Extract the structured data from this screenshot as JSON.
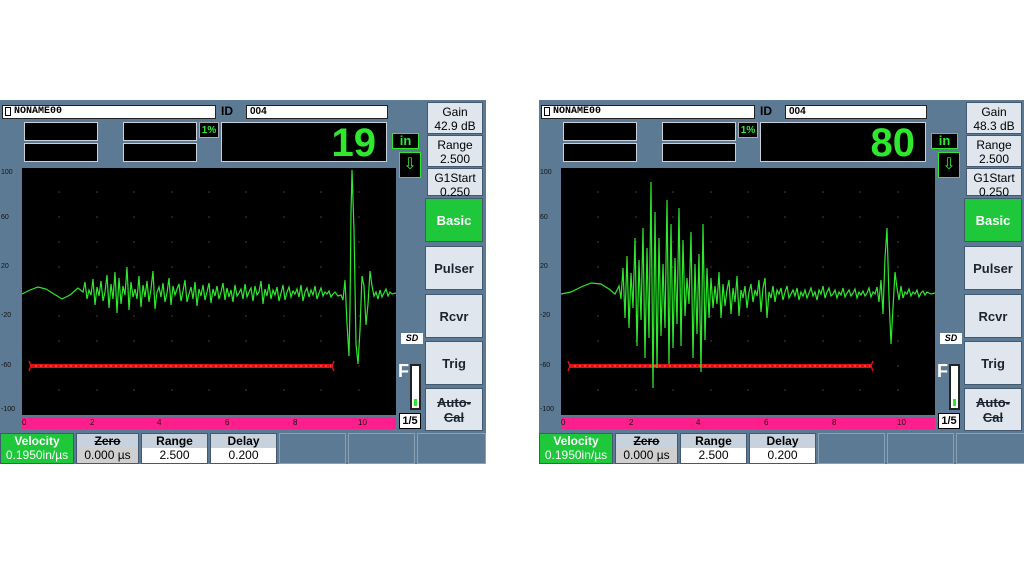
{
  "left": {
    "filename": "NONAME00",
    "id_label": "ID",
    "id_value": "004",
    "percent": "1%",
    "amplitude": "19",
    "units": "in",
    "gain_label": "Gain",
    "gain_value": "42.9 dB",
    "range_label": "Range",
    "range_value": "2.500",
    "g1start_label": "G1Start",
    "g1start_value": "0.250",
    "menu": [
      "Basic",
      "Pulser",
      "Rcvr",
      "Trig",
      "Auto-",
      "Cal"
    ],
    "y_ticks": [
      "100",
      "60",
      "20",
      "-20",
      "-60",
      "-100"
    ],
    "x_ticks": [
      "0",
      "2",
      "4",
      "6",
      "8",
      "10"
    ],
    "sd": "SD",
    "f": "F",
    "page": "1/5",
    "params": {
      "velocity_label": "Velocity",
      "velocity_value": "0.1950in/µs",
      "zero_label": "Zero",
      "zero_value": "0.000 µs",
      "range_label": "Range",
      "range_value": "2.500",
      "delay_label": "Delay",
      "delay_value": "0.200"
    }
  },
  "right": {
    "filename": "NONAME00",
    "id_label": "ID",
    "id_value": "004",
    "percent": "1%",
    "amplitude": "80",
    "units": "in",
    "gain_label": "Gain",
    "gain_value": "48.3 dB",
    "range_label": "Range",
    "range_value": "2.500",
    "g1start_label": "G1Start",
    "g1start_value": "0.250",
    "menu": [
      "Basic",
      "Pulser",
      "Rcvr",
      "Trig",
      "Auto-",
      "Cal"
    ],
    "y_ticks": [
      "100",
      "60",
      "20",
      "-20",
      "-60",
      "-100"
    ],
    "x_ticks": [
      "0",
      "2",
      "4",
      "6",
      "8",
      "10"
    ],
    "sd": "SD",
    "f": "F",
    "page": "1/5",
    "params": {
      "velocity_label": "Velocity",
      "velocity_value": "0.1950in/µs",
      "zero_label": "Zero",
      "zero_value": "0.000 µs",
      "range_label": "Range",
      "range_value": "2.500",
      "delay_label": "Delay",
      "delay_value": "0.200"
    }
  },
  "colors": {
    "trace": "#2ee82e",
    "gate": "#e01010",
    "ruler": "#ff1f8c",
    "selected": "#1fc83b",
    "panel": "#5d7a94"
  }
}
